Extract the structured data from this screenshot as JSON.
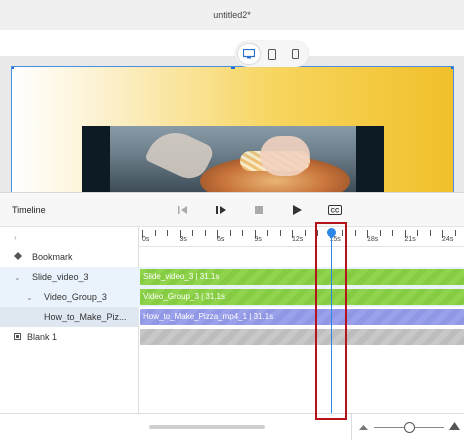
{
  "window": {
    "title": "untitled2*"
  },
  "devices": [
    {
      "icon": "desktop-icon",
      "active": true
    },
    {
      "icon": "tablet-icon",
      "active": false
    },
    {
      "icon": "mobile-icon",
      "active": false
    }
  ],
  "timeline": {
    "title": "Timeline",
    "controls": [
      "rewind-icon",
      "step-play-icon",
      "stop-icon",
      "play-icon",
      "closed-captions-icon"
    ],
    "ruler_labels": [
      "0s",
      "3s",
      "6s",
      "9s",
      "12s",
      "15s",
      "18s",
      "21s",
      "24s"
    ],
    "playhead_seconds": 15
  },
  "rows": [
    {
      "label": "Bookmark",
      "icon": "bookmark-diamond-icon"
    },
    {
      "label": "Slide_video_3",
      "icon": "chevron-down-icon"
    },
    {
      "label": "Video_Group_3",
      "icon": "chevron-down-icon"
    },
    {
      "label": "How_to_Make_Piz...",
      "icon": ""
    },
    {
      "label": "Blank 1",
      "icon": "slide-icon"
    }
  ],
  "clips": [
    {
      "label": "Slide_video_3 | 31.1s",
      "color": "#8fd44c"
    },
    {
      "label": "Video_Group_3 | 31.1s",
      "color": "#8fd44c"
    },
    {
      "label": "How_to_Make_Pizza_mp4_1 | 31.1s",
      "color": "#9aa0ea"
    },
    {
      "label": "",
      "color": "#c8c8c8"
    }
  ],
  "colors": {
    "accent": "#2d86e8",
    "highlight": "#b5121b"
  }
}
